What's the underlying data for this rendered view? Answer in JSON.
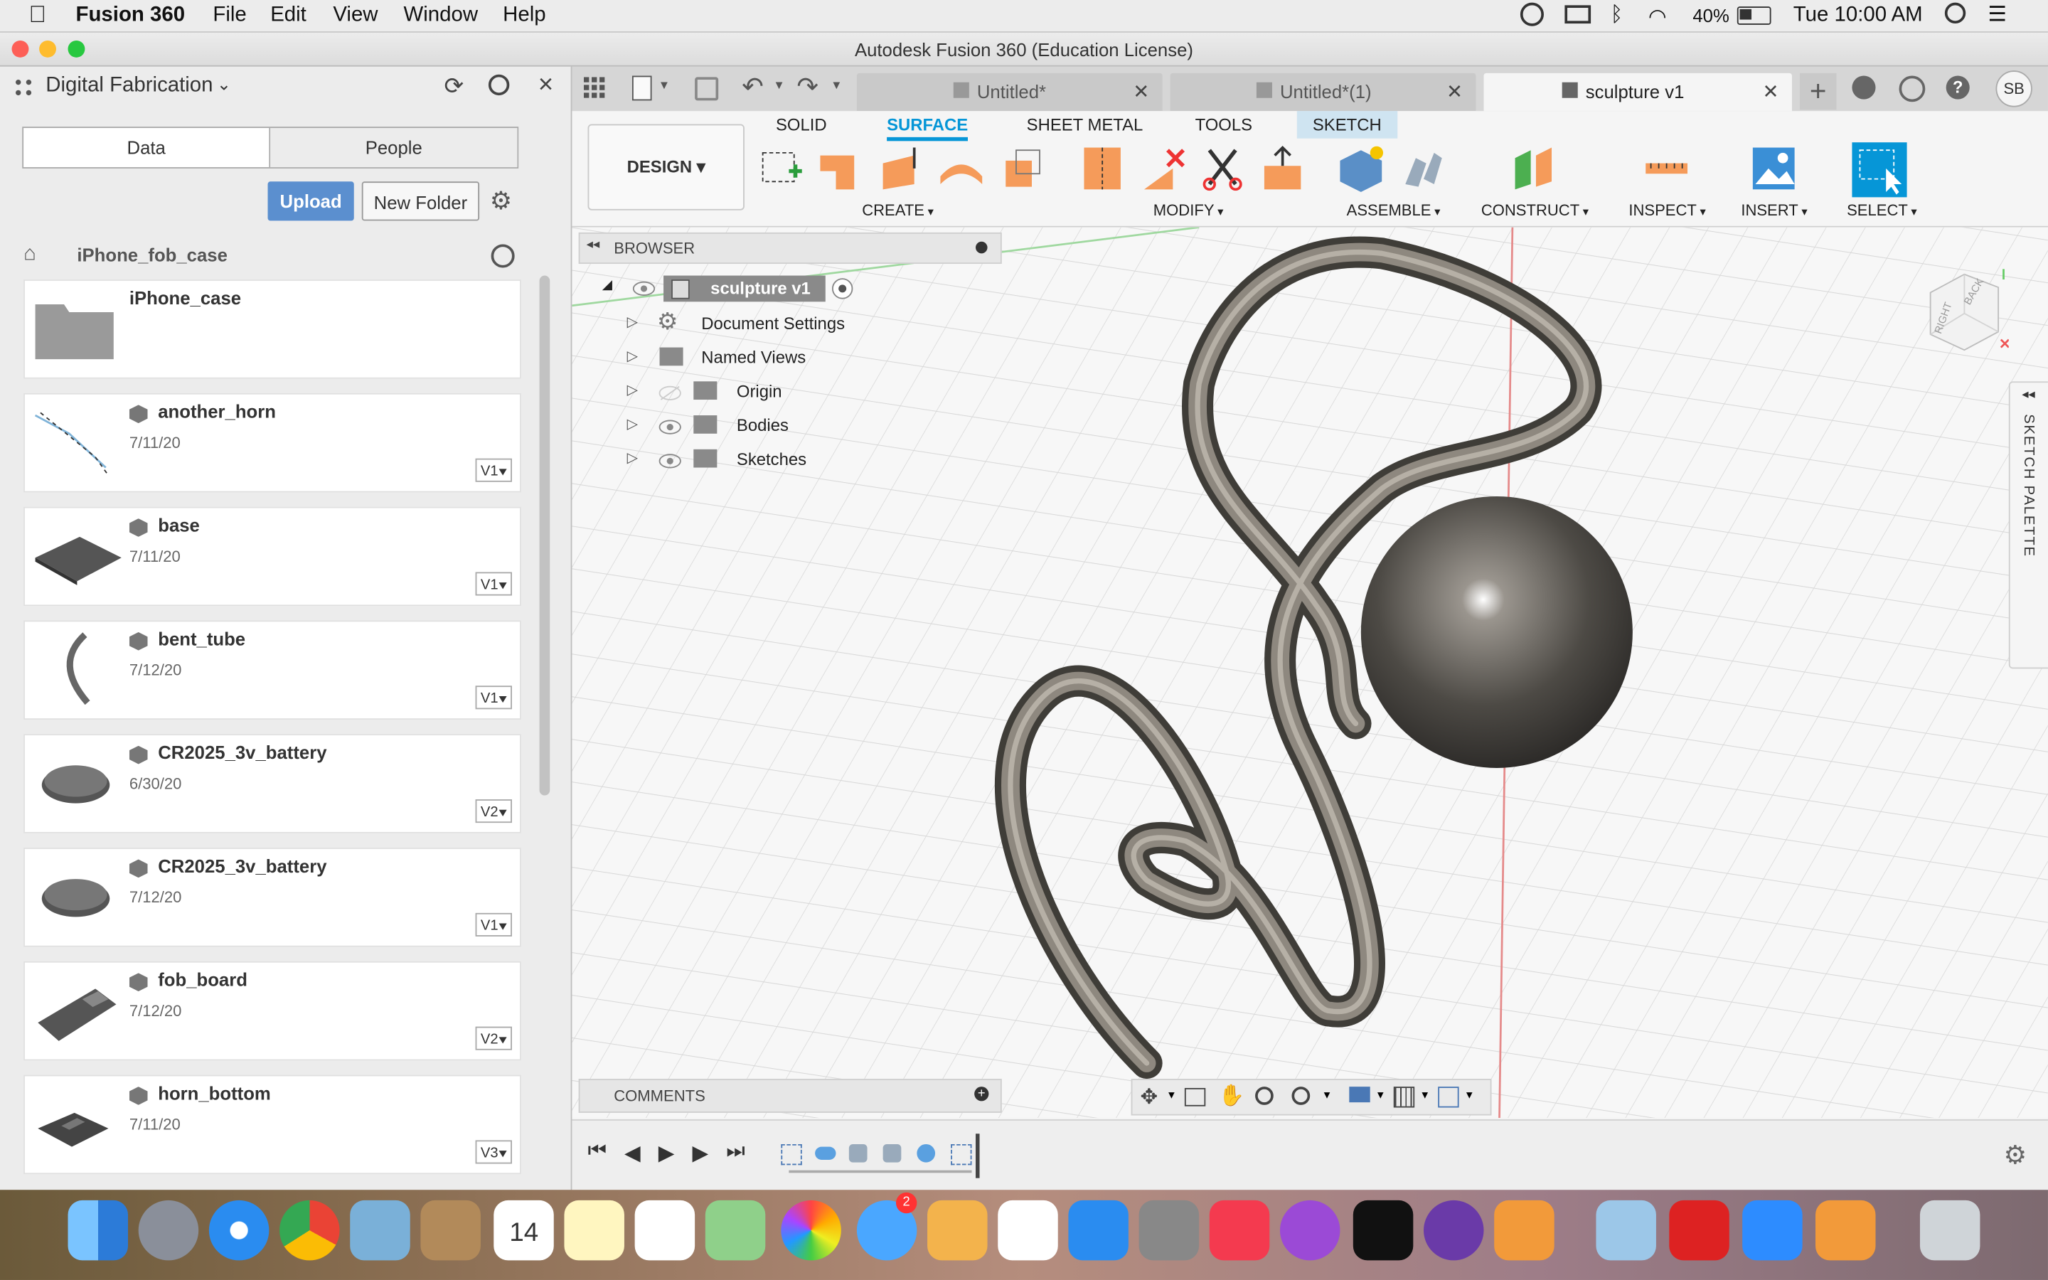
{
  "menubar": {
    "app_name": "Fusion 360",
    "items": [
      "File",
      "Edit",
      "View",
      "Window",
      "Help"
    ],
    "battery": "40%",
    "clock": "Tue 10:00 AM"
  },
  "window": {
    "title": "Autodesk Fusion 360 (Education License)"
  },
  "data_panel": {
    "project": "Digital Fabrication",
    "tabs": [
      "Data",
      "People"
    ],
    "upload_label": "Upload",
    "new_folder_label": "New Folder",
    "breadcrumb": "iPhone_fob_case",
    "items": [
      {
        "name": "iPhone_case",
        "date": "",
        "version": ""
      },
      {
        "name": "another_horn",
        "date": "7/11/20",
        "version": "V1"
      },
      {
        "name": "base",
        "date": "7/11/20",
        "version": "V1"
      },
      {
        "name": "bent_tube",
        "date": "7/12/20",
        "version": "V1"
      },
      {
        "name": "CR2025_3v_battery",
        "date": "6/30/20",
        "version": "V2"
      },
      {
        "name": "CR2025_3v_battery",
        "date": "7/12/20",
        "version": "V1"
      },
      {
        "name": "fob_board",
        "date": "7/12/20",
        "version": "V2"
      },
      {
        "name": "horn_bottom",
        "date": "7/11/20",
        "version": "V3"
      }
    ]
  },
  "doc_tabs": [
    {
      "label": "Untitled*"
    },
    {
      "label": "Untitled*(1)"
    },
    {
      "label": "sculpture v1"
    }
  ],
  "user_initials": "SB",
  "ribbon": {
    "workspace": "DESIGN",
    "tabs": [
      "SOLID",
      "SURFACE",
      "SHEET METAL",
      "TOOLS",
      "SKETCH"
    ],
    "active_tab": "SURFACE",
    "groups": [
      "CREATE",
      "MODIFY",
      "ASSEMBLE",
      "CONSTRUCT",
      "INSPECT",
      "INSERT",
      "SELECT"
    ],
    "accent": "#0696d7"
  },
  "browser": {
    "title": "BROWSER",
    "root": "sculpture v1",
    "nodes": [
      "Document Settings",
      "Named Views",
      "Origin",
      "Bodies",
      "Sketches"
    ]
  },
  "comments_label": "COMMENTS",
  "sketch_palette_label": "SKETCH PALETTE",
  "viewcube": {
    "faces": [
      "BACK",
      "RIGHT"
    ]
  }
}
